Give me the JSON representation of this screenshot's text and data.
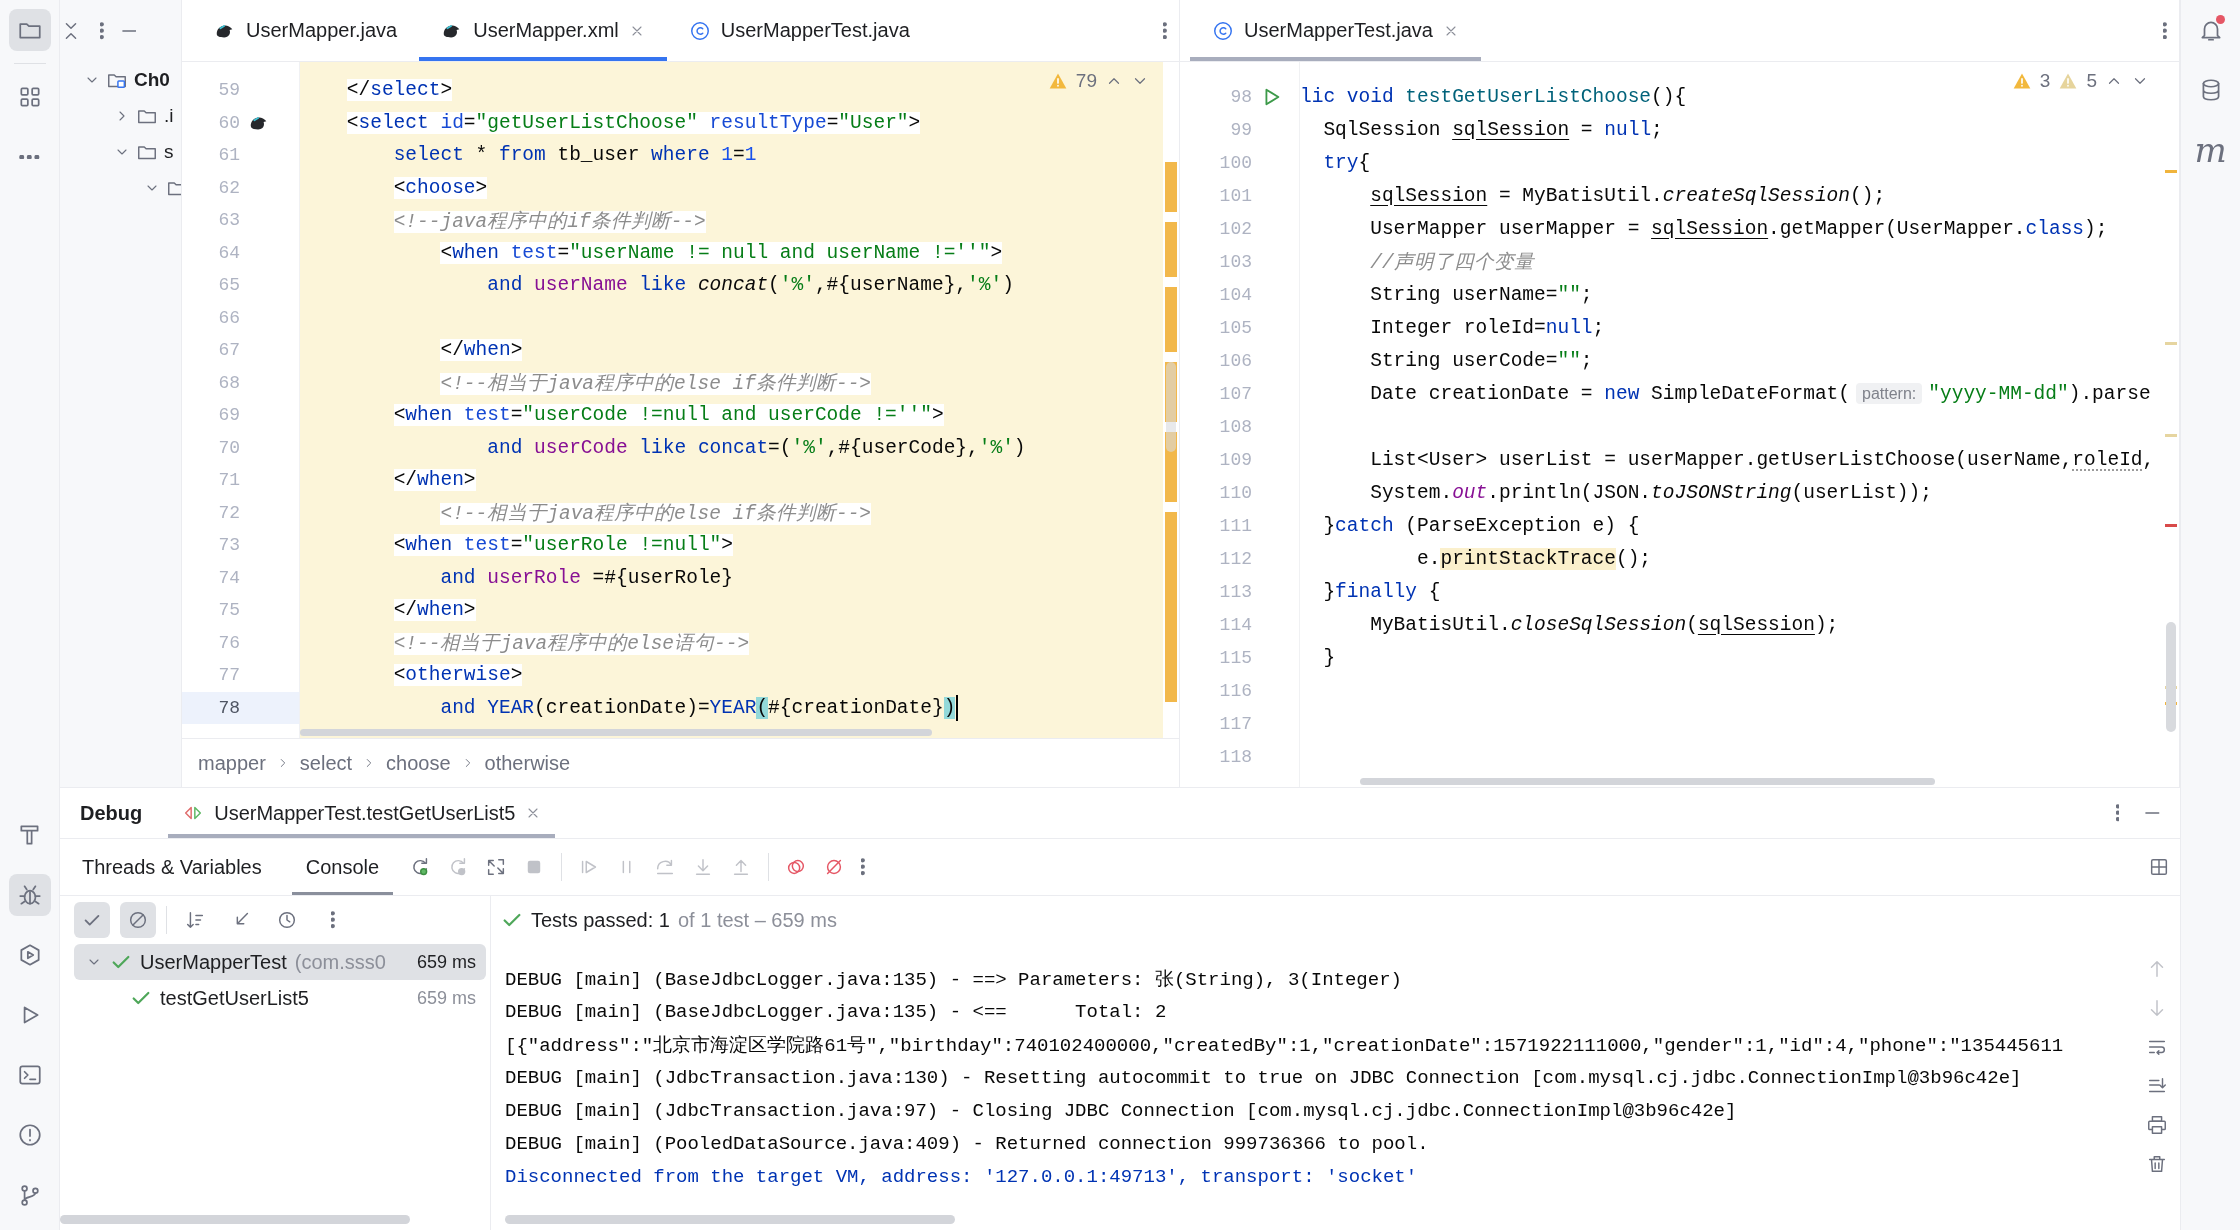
{
  "left_toolbar": {
    "top": [
      {
        "kind": "project",
        "selected": true
      },
      {
        "kind": "structure",
        "selected": false
      },
      {
        "kind": "more",
        "selected": false
      }
    ],
    "bottom": [
      {
        "kind": "build",
        "selected": false
      },
      {
        "kind": "debug",
        "selected": true
      },
      {
        "kind": "services",
        "selected": false
      },
      {
        "kind": "run",
        "selected": false
      },
      {
        "kind": "terminal",
        "selected": false
      },
      {
        "kind": "problems",
        "selected": false
      },
      {
        "kind": "git",
        "selected": false
      }
    ]
  },
  "project": {
    "tree": [
      {
        "label": "Ch0",
        "kind": "module",
        "expanded": true,
        "children": [
          {
            "label": ".i",
            "kind": "folder",
            "expanded": false
          },
          {
            "label": "s",
            "kind": "folder",
            "expanded": true,
            "children": [
              {
                "kind": "folder",
                "expanded": true
              }
            ]
          }
        ]
      }
    ]
  },
  "editors": [
    {
      "focused": true,
      "tabs": [
        {
          "label": "UserMapper.java",
          "kind": "mybatis",
          "selected": false
        },
        {
          "label": "UserMapper.xml",
          "kind": "mybatis",
          "selected": true
        },
        {
          "label": "UserMapperTest.java",
          "kind": "class",
          "selected": false
        }
      ],
      "inspections": [
        {
          "kind": "warning",
          "count": "79"
        }
      ],
      "lines": [
        {
          "number": "59",
          "kind": "xml",
          "current": false,
          "tokens": [
            {
              "text": "    </",
              "kind": "plain"
            },
            {
              "text": "select",
              "kind": "tag"
            },
            {
              "text": ">",
              "kind": "plain"
            }
          ]
        },
        {
          "number": "60",
          "kind": "xml",
          "current": false,
          "gutter": {
            "kind": "mybatis"
          },
          "tokens": [
            {
              "text": "    <",
              "kind": "plain"
            },
            {
              "text": "select",
              "kind": "tag"
            },
            {
              "text": " id",
              "kind": "attr"
            },
            {
              "text": "=",
              "kind": "plain"
            },
            {
              "text": "\"getUserListChoose\"",
              "kind": "str"
            },
            {
              "text": " resultType",
              "kind": "attr"
            },
            {
              "text": "=",
              "kind": "plain"
            },
            {
              "text": "\"User\"",
              "kind": "str"
            },
            {
              "text": ">",
              "kind": "plain"
            }
          ]
        },
        {
          "number": "61",
          "kind": "sql",
          "current": false,
          "tokens": [
            {
              "text": "        select",
              "kind": "kw"
            },
            {
              "text": " * ",
              "kind": "plain"
            },
            {
              "text": "from",
              "kind": "kw"
            },
            {
              "text": " tb_user ",
              "kind": "plain"
            },
            {
              "text": "where",
              "kind": "kw"
            },
            {
              "text": " 1",
              "kind": "num"
            },
            {
              "text": "=",
              "kind": "plain"
            },
            {
              "text": "1",
              "kind": "num"
            }
          ]
        },
        {
          "number": "62",
          "kind": "xml",
          "current": false,
          "tokens": [
            {
              "text": "        <",
              "kind": "plain"
            },
            {
              "text": "choose",
              "kind": "tag"
            },
            {
              "text": ">",
              "kind": "plain"
            }
          ]
        },
        {
          "number": "63",
          "kind": "xml",
          "current": false,
          "tokens": [
            {
              "text": "        <!--java程序中的if条件判断-->",
              "kind": "cmt"
            }
          ]
        },
        {
          "number": "64",
          "kind": "xml",
          "current": false,
          "tokens": [
            {
              "text": "            <",
              "kind": "plain"
            },
            {
              "text": "when",
              "kind": "tag"
            },
            {
              "text": " test",
              "kind": "attr"
            },
            {
              "text": "=",
              "kind": "plain"
            },
            {
              "text": "\"userName != null and userName !=''\"",
              "kind": "str"
            },
            {
              "text": ">",
              "kind": "plain"
            }
          ]
        },
        {
          "number": "65",
          "kind": "sql",
          "current": false,
          "tokens": [
            {
              "text": "                and",
              "kind": "kw"
            },
            {
              "text": " userName",
              "kind": "var"
            },
            {
              "text": " like",
              "kind": "kw"
            },
            {
              "text": " concat",
              "kind": "it"
            },
            {
              "text": "(",
              "kind": "plain"
            },
            {
              "text": "'%'",
              "kind": "str"
            },
            {
              "text": ",#{userName},",
              "kind": "plain"
            },
            {
              "text": "'%'",
              "kind": "str"
            },
            {
              "text": ")",
              "kind": "plain"
            }
          ]
        },
        {
          "number": "66",
          "kind": "sql",
          "current": false
        },
        {
          "number": "67",
          "kind": "xml",
          "current": false,
          "tokens": [
            {
              "text": "            </",
              "kind": "plain"
            },
            {
              "text": "when",
              "kind": "tag"
            },
            {
              "text": ">",
              "kind": "plain"
            }
          ]
        },
        {
          "number": "68",
          "kind": "xml",
          "current": false,
          "tokens": [
            {
              "text": "            <!--相当于java程序中的else if条件判断-->",
              "kind": "cmt"
            }
          ]
        },
        {
          "number": "69",
          "kind": "xml",
          "current": false,
          "tokens": [
            {
              "text": "        <",
              "kind": "plain"
            },
            {
              "text": "when",
              "kind": "tag"
            },
            {
              "text": " test",
              "kind": "attr"
            },
            {
              "text": "=",
              "kind": "plain"
            },
            {
              "text": "\"userCode !=null and userCode !=''\"",
              "kind": "str"
            },
            {
              "text": ">",
              "kind": "plain"
            }
          ]
        },
        {
          "number": "70",
          "kind": "sql",
          "current": false,
          "tokens": [
            {
              "text": "                and",
              "kind": "kw"
            },
            {
              "text": " userCode",
              "kind": "var"
            },
            {
              "text": " like",
              "kind": "kw"
            },
            {
              "text": " concat",
              "kind": "kw"
            },
            {
              "text": "=(",
              "kind": "plain"
            },
            {
              "text": "'%'",
              "kind": "str"
            },
            {
              "text": ",#{userCode},",
              "kind": "plain"
            },
            {
              "text": "'%'",
              "kind": "str"
            },
            {
              "text": ")",
              "kind": "plain"
            }
          ]
        },
        {
          "number": "71",
          "kind": "xml",
          "current": false,
          "tokens": [
            {
              "text": "        </",
              "kind": "plain"
            },
            {
              "text": "when",
              "kind": "tag"
            },
            {
              "text": ">",
              "kind": "plain"
            }
          ]
        },
        {
          "number": "72",
          "kind": "xml",
          "current": false,
          "tokens": [
            {
              "text": "            <!--相当于java程序中的else if条件判断-->",
              "kind": "cmt"
            }
          ]
        },
        {
          "number": "73",
          "kind": "xml",
          "current": false,
          "tokens": [
            {
              "text": "        <",
              "kind": "plain"
            },
            {
              "text": "when",
              "kind": "tag"
            },
            {
              "text": " test",
              "kind": "attr"
            },
            {
              "text": "=",
              "kind": "plain"
            },
            {
              "text": "\"userRole !=null\"",
              "kind": "str"
            },
            {
              "text": ">",
              "kind": "plain"
            }
          ]
        },
        {
          "number": "74",
          "kind": "sql",
          "current": false,
          "tokens": [
            {
              "text": "            and",
              "kind": "kw"
            },
            {
              "text": " userRole",
              "kind": "var"
            },
            {
              "text": " =#{userRole}",
              "kind": "plain"
            }
          ]
        },
        {
          "number": "75",
          "kind": "xml",
          "current": false,
          "tokens": [
            {
              "text": "        </",
              "kind": "plain"
            },
            {
              "text": "when",
              "kind": "tag"
            },
            {
              "text": ">",
              "kind": "plain"
            }
          ]
        },
        {
          "number": "76",
          "kind": "xml",
          "current": false,
          "tokens": [
            {
              "text": "        <!--相当于java程序中的else语句-->",
              "kind": "cmt"
            }
          ]
        },
        {
          "number": "77",
          "kind": "xml",
          "current": false,
          "tokens": [
            {
              "text": "        <",
              "kind": "plain"
            },
            {
              "text": "otherwise",
              "kind": "tag"
            },
            {
              "text": ">",
              "kind": "plain"
            }
          ]
        },
        {
          "number": "78",
          "kind": "sql",
          "current": true,
          "tokens": [
            {
              "text": "            and",
              "kind": "kw"
            },
            {
              "text": " YEAR",
              "kind": "kw"
            },
            {
              "text": "(creationDate)=",
              "kind": "plain"
            },
            {
              "text": "YEAR",
              "kind": "kw"
            },
            {
              "text": "(",
              "kind": "match"
            },
            {
              "text": "#{creationDate}",
              "kind": "plain"
            },
            {
              "text": ")",
              "kind": "match"
            }
          ]
        }
      ],
      "breadcrumbs": [
        "mapper",
        "select",
        "choose",
        "otherwise"
      ]
    },
    {
      "focused": false,
      "tabs": [
        {
          "label": "UserMapperTest.java",
          "kind": "class",
          "selected": true
        }
      ],
      "inspections": [
        {
          "kind": "warning",
          "count": "3"
        },
        {
          "kind": "weak_warning",
          "count": "5"
        }
      ],
      "lines": [
        {
          "number": "98",
          "kind": "java",
          "current": false,
          "gutter": {
            "kind": "run"
          },
          "tokens": [
            {
              "text": "lic void",
              "kind": "kw"
            },
            {
              "text": " testGetUserListChoose",
              "kind": "fn"
            },
            {
              "text": "(){",
              "kind": "plain"
            }
          ]
        },
        {
          "number": "99",
          "kind": "java",
          "current": false,
          "tokens": [
            {
              "text": "  SqlSession ",
              "kind": "plain"
            },
            {
              "text": "sqlSession",
              "kind": "und"
            },
            {
              "text": " = ",
              "kind": "plain"
            },
            {
              "text": "null",
              "kind": "kw"
            },
            {
              "text": ";",
              "kind": "plain"
            }
          ]
        },
        {
          "number": "100",
          "kind": "java",
          "current": false,
          "tokens": [
            {
              "text": "  try",
              "kind": "kw"
            },
            {
              "text": "{",
              "kind": "plain"
            }
          ]
        },
        {
          "number": "101",
          "kind": "java",
          "current": false,
          "tokens": [
            {
              "text": "      sqlSession",
              "kind": "und"
            },
            {
              "text": " = MyBatisUtil.",
              "kind": "plain"
            },
            {
              "text": "createSqlSession",
              "kind": "it"
            },
            {
              "text": "();",
              "kind": "plain"
            }
          ]
        },
        {
          "number": "102",
          "kind": "java",
          "current": false,
          "tokens": [
            {
              "text": "      UserMapper userMapper = ",
              "kind": "plain"
            },
            {
              "text": "sqlSession",
              "kind": "und"
            },
            {
              "text": ".getMapper(UserMapper.",
              "kind": "plain"
            },
            {
              "text": "class",
              "kind": "kw"
            },
            {
              "text": ");",
              "kind": "plain"
            }
          ]
        },
        {
          "number": "103",
          "kind": "java",
          "current": false,
          "tokens": [
            {
              "text": "      //声明了四个变量",
              "kind": "cmt"
            }
          ]
        },
        {
          "number": "104",
          "kind": "java",
          "current": false,
          "tokens": [
            {
              "text": "      String userName=",
              "kind": "plain"
            },
            {
              "text": "\"\"",
              "kind": "str"
            },
            {
              "text": ";",
              "kind": "plain"
            }
          ]
        },
        {
          "number": "105",
          "kind": "java",
          "current": false,
          "tokens": [
            {
              "text": "      Integer roleId=",
              "kind": "plain"
            },
            {
              "text": "null",
              "kind": "kw"
            },
            {
              "text": ";",
              "kind": "plain"
            }
          ]
        },
        {
          "number": "106",
          "kind": "java",
          "current": false,
          "tokens": [
            {
              "text": "      String userCode=",
              "kind": "plain"
            },
            {
              "text": "\"\"",
              "kind": "str"
            },
            {
              "text": ";",
              "kind": "plain"
            }
          ]
        },
        {
          "number": "107",
          "kind": "java",
          "current": false,
          "tokens": [
            {
              "text": "      Date creationDate = ",
              "kind": "plain"
            },
            {
              "text": "new",
              "kind": "kw"
            },
            {
              "text": " SimpleDateFormat(",
              "kind": "plain"
            },
            {
              "text": "pattern:",
              "kind": "hint"
            },
            {
              "text": "\"yyyy-MM-dd\"",
              "kind": "str"
            },
            {
              "text": ").parse",
              "kind": "plain"
            }
          ]
        },
        {
          "number": "108",
          "kind": "java",
          "current": false
        },
        {
          "number": "109",
          "kind": "java",
          "current": false,
          "tokens": [
            {
              "text": "      List<User> userList = userMapper.getUserListChoose(userName,",
              "kind": "plain"
            },
            {
              "text": "roleId",
              "kind": "wavy"
            },
            {
              "text": ",",
              "kind": "plain"
            }
          ]
        },
        {
          "number": "110",
          "kind": "java",
          "current": false,
          "tokens": [
            {
              "text": "      System.",
              "kind": "plain"
            },
            {
              "text": "out",
              "kind": "vit"
            },
            {
              "text": ".println(JSON.",
              "kind": "plain"
            },
            {
              "text": "toJSONString",
              "kind": "it"
            },
            {
              "text": "(userList));",
              "kind": "plain"
            }
          ]
        },
        {
          "number": "111",
          "kind": "java",
          "current": false,
          "tokens": [
            {
              "text": "  }",
              "kind": "plain"
            },
            {
              "text": "catch",
              "kind": "kw"
            },
            {
              "text": " (ParseException e) {",
              "kind": "plain"
            }
          ]
        },
        {
          "number": "112",
          "kind": "java",
          "current": false,
          "tokens": [
            {
              "text": "          e.",
              "kind": "plain"
            },
            {
              "text": "printStackTrace",
              "kind": "hl"
            },
            {
              "text": "();",
              "kind": "plain"
            }
          ]
        },
        {
          "number": "113",
          "kind": "java",
          "current": false,
          "tokens": [
            {
              "text": "  }",
              "kind": "plain"
            },
            {
              "text": "finally",
              "kind": "kw"
            },
            {
              "text": " {",
              "kind": "plain"
            }
          ]
        },
        {
          "number": "114",
          "kind": "java",
          "current": false,
          "tokens": [
            {
              "text": "      MyBatisUtil.",
              "kind": "plain"
            },
            {
              "text": "closeSqlSession",
              "kind": "it"
            },
            {
              "text": "(",
              "kind": "plain"
            },
            {
              "text": "sqlSession",
              "kind": "und"
            },
            {
              "text": ");",
              "kind": "plain"
            }
          ]
        },
        {
          "number": "115",
          "kind": "java",
          "current": false,
          "tokens": [
            {
              "text": "  }",
              "kind": "plain"
            }
          ]
        },
        {
          "number": "116",
          "kind": "java",
          "current": false
        },
        {
          "number": "117",
          "kind": "java",
          "current": false
        },
        {
          "number": "118",
          "kind": "java",
          "current": false
        }
      ]
    }
  ],
  "debug": {
    "title": "Debug",
    "tabs": [
      {
        "label": "UserMapperTest.testGetUserList5",
        "selected": true
      }
    ],
    "view_tabs": [
      {
        "label": "Threads & Variables",
        "selected": false
      },
      {
        "label": "Console",
        "selected": true
      }
    ],
    "actions": [
      {
        "kind": "rerun",
        "disabled": false
      },
      {
        "kind": "rerun_failed",
        "disabled": true
      },
      {
        "kind": "restore_layout",
        "disabled": false
      },
      {
        "kind": "stop",
        "disabled": true
      },
      {
        "kind": "resume",
        "disabled": true
      },
      {
        "kind": "pause",
        "disabled": true
      },
      {
        "kind": "step_over",
        "disabled": true
      },
      {
        "kind": "step_into",
        "disabled": true
      },
      {
        "kind": "step_out",
        "disabled": true
      },
      {
        "kind": "view_breakpoints",
        "disabled": false
      },
      {
        "kind": "mute_breakpoints",
        "disabled": false
      }
    ],
    "tree_toolbar": [
      {
        "kind": "show_passed",
        "selected": true
      },
      {
        "kind": "show_ignored",
        "selected": true
      },
      {
        "kind": "sort",
        "selected": false
      },
      {
        "kind": "collapse",
        "selected": false
      },
      {
        "kind": "history",
        "selected": false
      },
      {
        "kind": "more",
        "selected": false
      }
    ],
    "tests": [
      {
        "name": "UserMapperTest",
        "package": "(com.sss0",
        "duration": "659 ms",
        "passed": true,
        "expanded": true,
        "selected": true,
        "children": [
          {
            "name": "testGetUserList5",
            "duration": "659 ms",
            "passed": true,
            "selected": false
          }
        ]
      }
    ],
    "summary": {
      "status": "Tests passed: 1",
      "detail": "of 1 test – 659 ms",
      "passed": true
    },
    "console": [
      {
        "kind": "log",
        "text": "DEBUG [main] (BaseJdbcLogger.java:135) - ==> Parameters: 张(String), 3(Integer)"
      },
      {
        "kind": "log",
        "text": "DEBUG [main] (BaseJdbcLogger.java:135) - <==      Total: 2"
      },
      {
        "kind": "output",
        "text": "[{\"address\":\"北京市海淀区学院路61号\",\"birthday\":740102400000,\"createdBy\":1,\"creationDate\":1571922111000,\"gender\":1,\"id\":4,\"phone\":\"135445611"
      },
      {
        "kind": "log",
        "text": "DEBUG [main] (JdbcTransaction.java:130) - Resetting autocommit to true on JDBC Connection [com.mysql.cj.jdbc.ConnectionImpl@3b96c42e]"
      },
      {
        "kind": "log",
        "text": "DEBUG [main] (JdbcTransaction.java:97) - Closing JDBC Connection [com.mysql.cj.jdbc.ConnectionImpl@3b96c42e]"
      },
      {
        "kind": "log",
        "text": "DEBUG [main] (PooledDataSource.java:409) - Returned connection 999736366 to pool."
      },
      {
        "kind": "system",
        "text": "Disconnected from the target VM, address: '127.0.0.1:49713', transport: 'socket'"
      }
    ],
    "console_actions": [
      {
        "kind": "up",
        "disabled": true
      },
      {
        "kind": "down",
        "disabled": true
      },
      {
        "kind": "soft_wrap",
        "disabled": false
      },
      {
        "kind": "scroll_to_end",
        "disabled": false
      },
      {
        "kind": "print",
        "disabled": false
      },
      {
        "kind": "clear",
        "disabled": false
      }
    ]
  },
  "right_toolbar": [
    {
      "kind": "notifications",
      "badge": true
    },
    {
      "kind": "database",
      "badge": false
    },
    {
      "kind": "maven",
      "glyph": "m",
      "badge": false
    }
  ]
}
